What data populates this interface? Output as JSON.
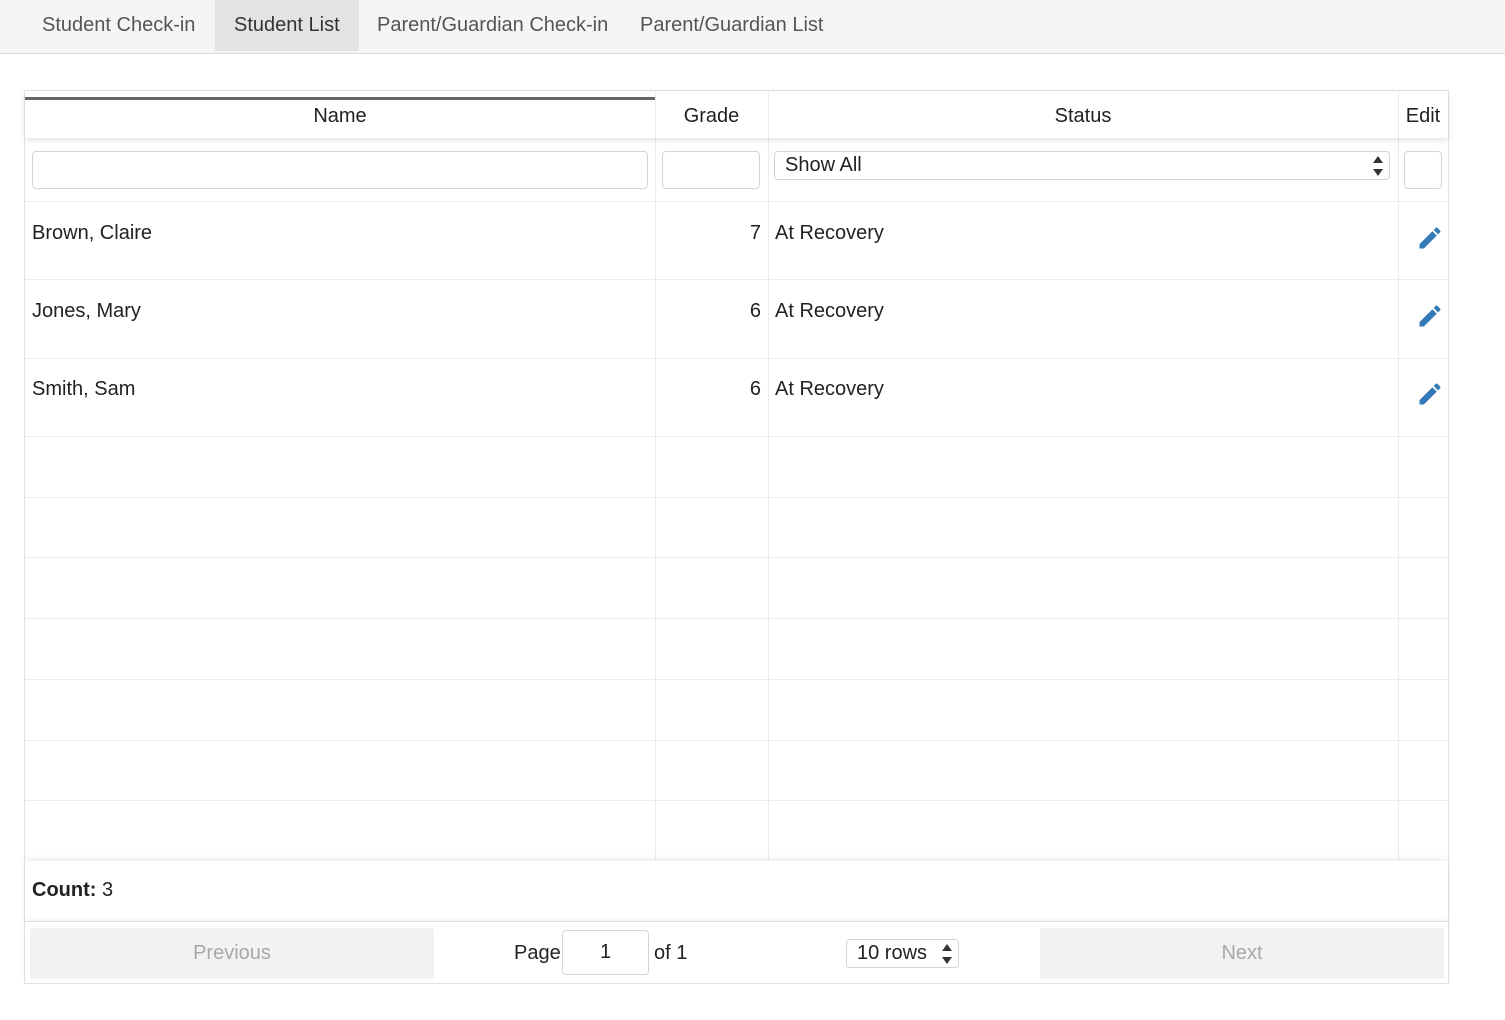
{
  "tabs": [
    {
      "label": "Student Check-in",
      "active": false
    },
    {
      "label": "Student List",
      "active": true
    },
    {
      "label": "Parent/Guardian Check-in",
      "active": false
    },
    {
      "label": "Parent/Guardian List",
      "active": false
    }
  ],
  "table": {
    "columns": {
      "name": "Name",
      "grade": "Grade",
      "status": "Status",
      "edit": "Edit"
    },
    "filters": {
      "name_value": "",
      "grade_value": "",
      "status_selected": "Show All"
    },
    "rows": [
      {
        "name": "Brown, Claire",
        "grade": "7",
        "status": "At Recovery",
        "edit_icon": "pencil-icon"
      },
      {
        "name": "Jones, Mary",
        "grade": "6",
        "status": "At Recovery",
        "edit_icon": "pencil-icon"
      },
      {
        "name": "Smith, Sam",
        "grade": "6",
        "status": "At Recovery",
        "edit_icon": "pencil-icon"
      }
    ],
    "footer": {
      "count_label": "Count:",
      "count_value": "3"
    }
  },
  "pagination": {
    "previous_label": "Previous",
    "page_label": "Page",
    "page_value": "1",
    "of_label": "of 1",
    "rows_selected": "10 rows",
    "next_label": "Next"
  },
  "colors": {
    "accent": "#337ab7",
    "tab_active_bg": "#e3e3e3",
    "disabled_button_text": "#a8a8a8"
  }
}
